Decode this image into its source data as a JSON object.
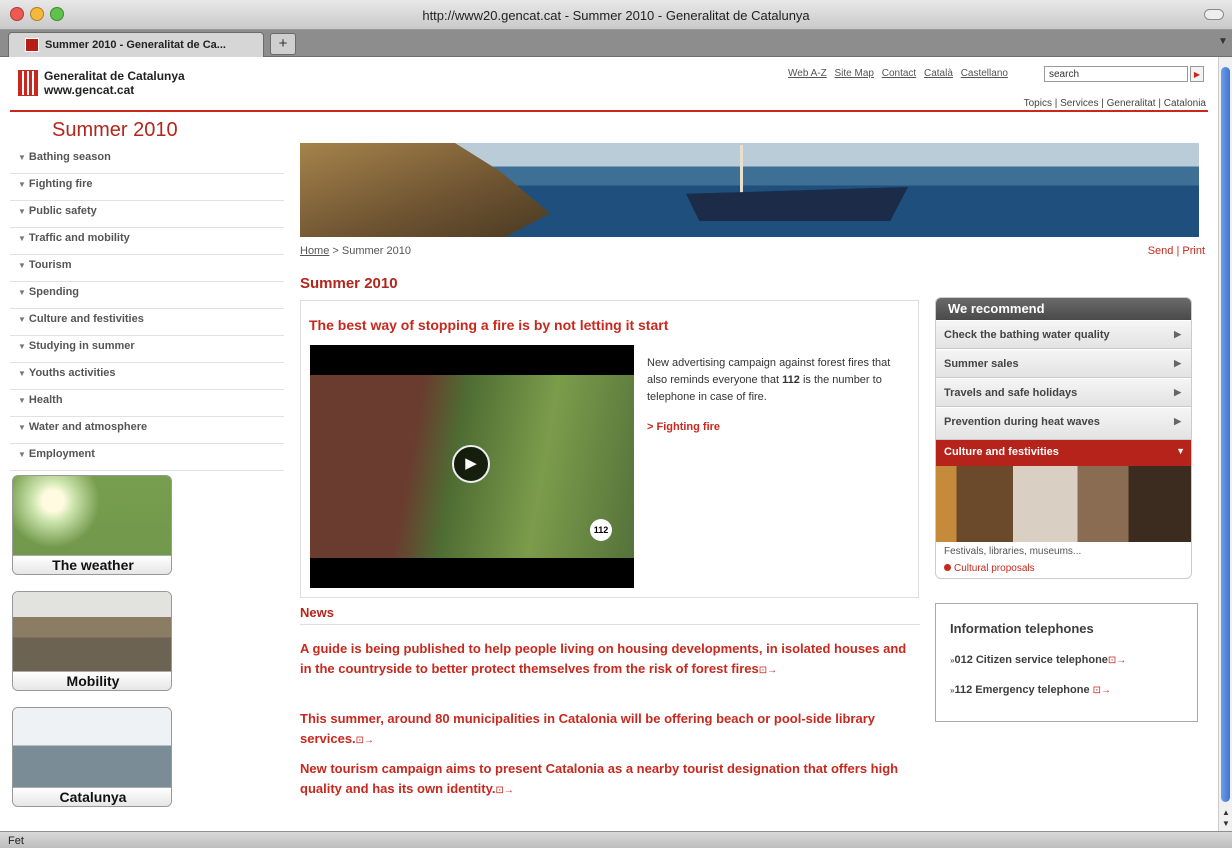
{
  "window": {
    "title": "http://www20.gencat.cat - Summer 2010 - Generalitat de Catalunya",
    "tab_label": "Summer 2010 - Generalitat de Ca...",
    "status": "Fet"
  },
  "header": {
    "org_name": "Generalitat de Catalunya",
    "org_url": "www.gencat.cat",
    "links": [
      "Web A-Z",
      "Site Map",
      "Contact",
      "Català",
      "Castellano"
    ],
    "search_value": "search",
    "subnav": [
      "Topics",
      "Services",
      "Generalitat",
      "Catalonia"
    ]
  },
  "sidebar": {
    "title": "Summer 2010",
    "items": [
      "Bathing season",
      "Fighting fire",
      "Public safety",
      "Traffic and mobility",
      "Tourism",
      "Spending",
      "Culture and festivities",
      "Studying in summer",
      "Youths activities",
      "Health",
      "Water and atmosphere",
      "Employment"
    ],
    "promos": [
      "The weather",
      "Mobility",
      "Catalunya"
    ]
  },
  "main": {
    "breadcrumb_home": "Home",
    "breadcrumb_sep": ">",
    "breadcrumb_current": "Summer 2010",
    "send_print": "Send | Print",
    "title": "Summer 2010",
    "feature": {
      "headline": "The best way of stopping a fire is by not letting it start",
      "text_before": "New advertising campaign against forest fires that also reminds everyone that ",
      "text_bold": "112",
      "text_after": " is the number to telephone in case of fire.",
      "link": "> Fighting fire",
      "video_badge": "112"
    },
    "news_title": "News",
    "news": [
      "A guide is being published to help people living on housing developments, in isolated houses and in the countryside to better protect themselves from the risk of forest fires",
      "This summer, around 80 municipalities in Catalonia will be offering beach or pool-side library services.",
      "New tourism campaign aims to present Catalonia as a nearby tourist designation that offers high quality and has its own identity."
    ]
  },
  "recommend": {
    "title": "We recommend",
    "items": [
      "Check the bathing water quality",
      "Summer sales",
      "Travels and safe holidays",
      "Prevention during heat waves"
    ],
    "active": "Culture and festivities",
    "desc": "Festivals, libraries, museums...",
    "link": "Cultural proposals"
  },
  "telephones": {
    "title": "Information telephones",
    "items": [
      "012 Citizen service telephone",
      "112 Emergency telephone"
    ]
  },
  "colors": {
    "accent": "#c8281d",
    "title_red": "#b2261c"
  }
}
